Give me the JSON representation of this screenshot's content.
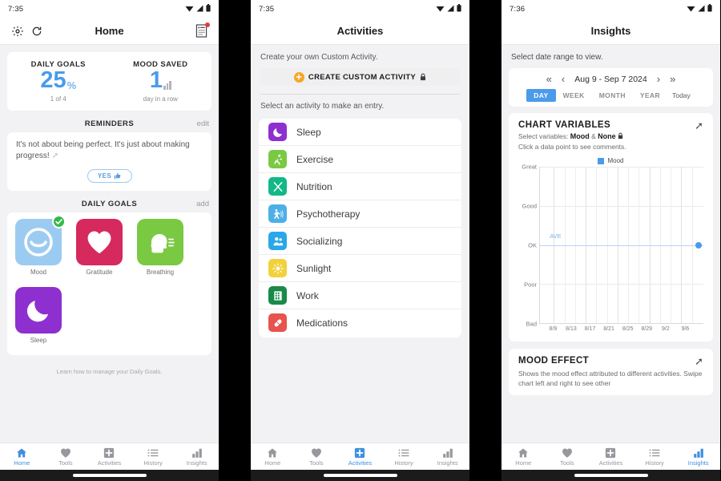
{
  "screens": [
    {
      "statusbar": {
        "time": "7:35"
      },
      "appbar": {
        "title": "Home"
      },
      "stats": [
        {
          "label": "DAILY GOALS",
          "value": "25",
          "unit": "%",
          "sub": "1 of 4"
        },
        {
          "label": "MOOD SAVED",
          "value": "1",
          "unit": "",
          "sub": "day in a row"
        }
      ],
      "reminders": {
        "title": "REMINDERS",
        "action": "edit",
        "text": "It's not about being perfect. It's just about making progress!",
        "yes_label": "YES"
      },
      "daily_goals": {
        "title": "DAILY GOALS",
        "action": "add",
        "items": [
          {
            "name": "Mood",
            "color": "#9ccbf2",
            "icon": "smile-icon",
            "completed": true
          },
          {
            "name": "Gratitude",
            "color": "#d6295e",
            "icon": "heart-icon",
            "completed": false
          },
          {
            "name": "Breathing",
            "color": "#7ac943",
            "icon": "breathing-head-icon",
            "completed": false
          },
          {
            "name": "Sleep",
            "color": "#8e2fd0",
            "icon": "moon-icon",
            "completed": false
          }
        ]
      },
      "footnote": "Learn how to manage your Daily Goals.",
      "nav": [
        {
          "label": "Home",
          "icon": "home-icon",
          "active": true
        },
        {
          "label": "Tools",
          "icon": "heart-icon",
          "active": false
        },
        {
          "label": "Activities",
          "icon": "plus-square-icon",
          "active": false
        },
        {
          "label": "History",
          "icon": "list-icon",
          "active": false
        },
        {
          "label": "Insights",
          "icon": "bar-chart-icon",
          "active": false
        }
      ]
    },
    {
      "statusbar": {
        "time": "7:35"
      },
      "appbar": {
        "title": "Activities"
      },
      "custom": {
        "hint": "Create your own Custom Activity.",
        "button_label": "CREATE CUSTOM ACTIVITY"
      },
      "select_hint": "Select an activity to make an entry.",
      "activities": [
        {
          "name": "Sleep",
          "color": "#8e2fd0",
          "icon": "moon-icon"
        },
        {
          "name": "Exercise",
          "color": "#7ac943",
          "icon": "runner-icon"
        },
        {
          "name": "Nutrition",
          "color": "#12b886",
          "icon": "utensils-icon"
        },
        {
          "name": "Psychotherapy",
          "color": "#4dafe8",
          "icon": "therapy-icon"
        },
        {
          "name": "Socializing",
          "color": "#2aa7e8",
          "icon": "people-icon"
        },
        {
          "name": "Sunlight",
          "color": "#f2d23c",
          "icon": "sun-icon"
        },
        {
          "name": "Work",
          "color": "#1a8a4a",
          "icon": "building-icon"
        },
        {
          "name": "Medications",
          "color": "#e8524f",
          "icon": "pill-icon"
        }
      ],
      "nav": [
        {
          "label": "Home",
          "icon": "home-icon",
          "active": false
        },
        {
          "label": "Tools",
          "icon": "heart-icon",
          "active": false
        },
        {
          "label": "Activities",
          "icon": "plus-square-icon",
          "active": true
        },
        {
          "label": "History",
          "icon": "list-icon",
          "active": false
        },
        {
          "label": "Insights",
          "icon": "bar-chart-icon",
          "active": false
        }
      ]
    },
    {
      "statusbar": {
        "time": "7:36"
      },
      "appbar": {
        "title": "Insights"
      },
      "date": {
        "hint": "Select date range to view.",
        "range": "Aug 9 - Sep 7  2024",
        "tabs": [
          "DAY",
          "WEEK",
          "MONTH",
          "YEAR"
        ],
        "active_tab": "DAY",
        "today_label": "Today"
      },
      "chart_panel": {
        "title": "CHART VARIABLES",
        "select_prefix": "Select variables:",
        "var_a": "Mood",
        "amp": "&",
        "var_b": "None",
        "click_hint": "Click a data point to see comments."
      },
      "mood_effect": {
        "title": "MOOD EFFECT",
        "description": "Shows the mood effect attributed to different activities. Swipe chart left and right to see other"
      },
      "nav": [
        {
          "label": "Home",
          "icon": "home-icon",
          "active": false
        },
        {
          "label": "Tools",
          "icon": "heart-icon",
          "active": false
        },
        {
          "label": "Activities",
          "icon": "plus-square-icon",
          "active": false
        },
        {
          "label": "History",
          "icon": "list-icon",
          "active": false
        },
        {
          "label": "Insights",
          "icon": "bar-chart-icon",
          "active": true
        }
      ]
    }
  ],
  "chart_data": {
    "type": "line",
    "title": "Mood",
    "xlabel": "",
    "ylabel": "",
    "legend": [
      {
        "name": "Mood",
        "color": "#4a9bea"
      }
    ],
    "legend_position": "top",
    "grid": true,
    "y_categories": [
      "Bad",
      "Poor",
      "OK",
      "Good",
      "Great"
    ],
    "ylim": [
      0,
      4
    ],
    "x_ticks": [
      "8/9",
      "8/13",
      "8/17",
      "8/21",
      "8/25",
      "8/29",
      "9/2",
      "9/6"
    ],
    "average_label": "AVE",
    "average_value": 2,
    "series": [
      {
        "name": "Mood",
        "color": "#4a9bea",
        "points": [
          {
            "x": "9/7",
            "y": 2,
            "y_label": "OK"
          }
        ]
      }
    ]
  }
}
